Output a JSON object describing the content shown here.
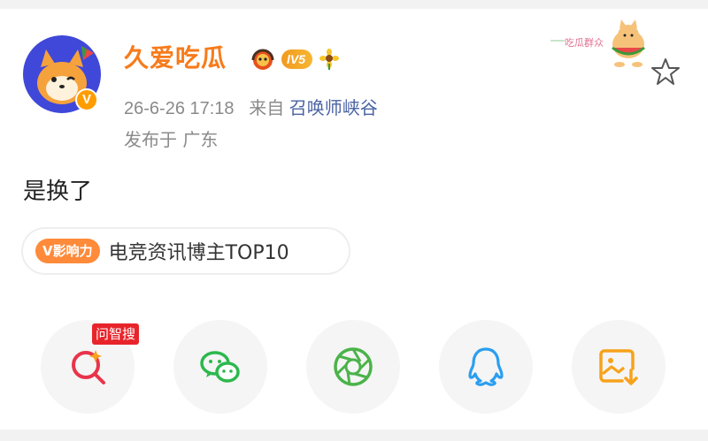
{
  "post": {
    "username": "久爱吃瓜",
    "level_badge": "lV5",
    "timestamp": "26-6-26 17:18",
    "source_prefix": "来自",
    "source_name": "召唤师峡谷",
    "location": "发布于 广东",
    "content": "是换了",
    "decoration_text": "吃瓜群众"
  },
  "influence": {
    "tag": "V影响力",
    "text": "电竞资讯博主TOP10"
  },
  "share": {
    "ai_search_tag": "问智搜",
    "items": [
      {
        "icon": "ai-search-icon",
        "color": "#e8344a"
      },
      {
        "icon": "wechat-icon",
        "color": "#2db84d"
      },
      {
        "icon": "moments-icon",
        "color": "#4bb34a"
      },
      {
        "icon": "qq-icon",
        "color": "#2b9ef0"
      },
      {
        "icon": "save-image-icon",
        "color": "#f7a21b"
      }
    ]
  },
  "colors": {
    "username": "#f77b1b",
    "source": "#4a63a3",
    "avatar_bg": "#3f48d8",
    "influence_tag": "#ff8a3a"
  }
}
